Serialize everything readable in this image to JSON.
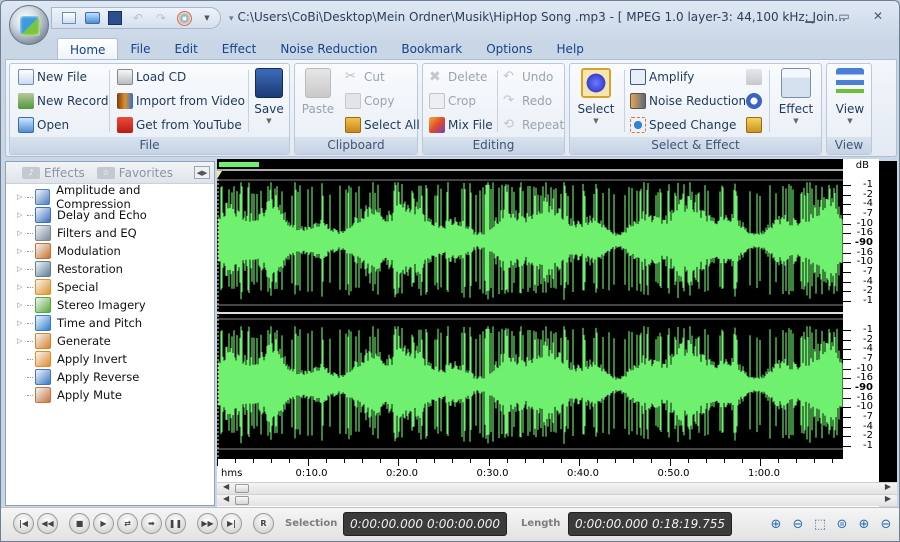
{
  "window": {
    "title": "C:\\Users\\CoBi\\Desktop\\Mein Ordner\\Musik\\HipHop Song .mp3 - [ MPEG 1.0 layer-3: 44,100 kHz; Join...",
    "controls": [
      "minimize",
      "maximize",
      "close"
    ]
  },
  "quick_access": [
    {
      "name": "new-file",
      "icon": "new-file-icon"
    },
    {
      "name": "open",
      "icon": "open-folder-icon"
    },
    {
      "name": "save",
      "icon": "save-icon"
    },
    {
      "name": "undo",
      "icon": "undo-icon"
    },
    {
      "name": "redo",
      "icon": "redo-icon"
    },
    {
      "name": "burn-cd",
      "icon": "cd-icon"
    }
  ],
  "tabs": [
    "Home",
    "File",
    "Edit",
    "Effect",
    "Noise Reduction",
    "Bookmark",
    "Options",
    "Help"
  ],
  "active_tab": "Home",
  "ribbon": {
    "file": {
      "label": "File",
      "new_file": "New File",
      "new_record": "New Record",
      "open": "Open",
      "load_cd": "Load CD",
      "import_video": "Import from Video",
      "get_youtube": "Get from YouTube",
      "save": "Save"
    },
    "clipboard": {
      "label": "Clipboard",
      "paste": "Paste",
      "cut": "Cut",
      "copy": "Copy",
      "select_all": "Select All"
    },
    "editing": {
      "label": "Editing",
      "delete": "Delete",
      "crop": "Crop",
      "mix_file": "Mix File",
      "undo": "Undo",
      "redo": "Redo",
      "repeat": "Repeat"
    },
    "select_effect": {
      "label": "Select & Effect",
      "select": "Select",
      "amplify": "Amplify",
      "noise_reduction": "Noise Reduction",
      "speed_change": "Speed Change",
      "effect": "Effect"
    },
    "view": {
      "label": "View",
      "view": "View"
    }
  },
  "left_panel": {
    "tabs": [
      "Effects",
      "Favorites"
    ],
    "items": [
      {
        "label": "Amplitude and Compression",
        "expandable": true,
        "color": "#4a7fc1"
      },
      {
        "label": "Delay and Echo",
        "expandable": true,
        "color": "#3d6fc4"
      },
      {
        "label": "Filters and EQ",
        "expandable": true,
        "color": "#7a8a99"
      },
      {
        "label": "Modulation",
        "expandable": true,
        "color": "#c9702c"
      },
      {
        "label": "Restoration",
        "expandable": true,
        "color": "#5a7f99"
      },
      {
        "label": "Special",
        "expandable": true,
        "color": "#e3902a"
      },
      {
        "label": "Stereo Imagery",
        "expandable": true,
        "color": "#5aa83a"
      },
      {
        "label": "Time and Pitch",
        "expandable": true,
        "color": "#2f7fd0"
      },
      {
        "label": "Generate",
        "expandable": true,
        "color": "#d9822b"
      },
      {
        "label": "Apply Invert",
        "expandable": false,
        "color": "#e48a2a"
      },
      {
        "label": "Apply Reverse",
        "expandable": false,
        "color": "#3a78c8"
      },
      {
        "label": "Apply Mute",
        "expandable": false,
        "color": "#c8743a"
      }
    ]
  },
  "waveform": {
    "channels": 2,
    "wave_color": "#6ff16f",
    "background": "#000000",
    "db_unit": "dB",
    "db_labels": [
      "-1",
      "-2",
      "-4",
      "-7",
      "-10",
      "-16",
      "-90",
      "-16",
      "-10",
      "-7",
      "-4",
      "-2",
      "-1"
    ]
  },
  "timeline": {
    "unit": "hms",
    "labels": [
      "0:10.0",
      "0:20.0",
      "0:30.0",
      "0:40.0",
      "0:50.0",
      "1:00.0"
    ]
  },
  "transport": {
    "buttons": [
      "go-to-start",
      "rewind",
      "stop",
      "play",
      "loop",
      "play-selection",
      "pause",
      "fast-forward",
      "go-to-end",
      "record"
    ],
    "record_label": "R",
    "selection_label": "Selection",
    "selection_start": "0:00:00.000",
    "selection_end": "0:00:00.000",
    "length_label": "Length",
    "length_start": "0:00:00.000",
    "length_total": "0:18:19.755",
    "zoom_buttons": [
      "zoom-in",
      "zoom-out",
      "zoom-selection",
      "zoom-full",
      "zoom-in-vertical",
      "zoom-out-vertical"
    ]
  }
}
